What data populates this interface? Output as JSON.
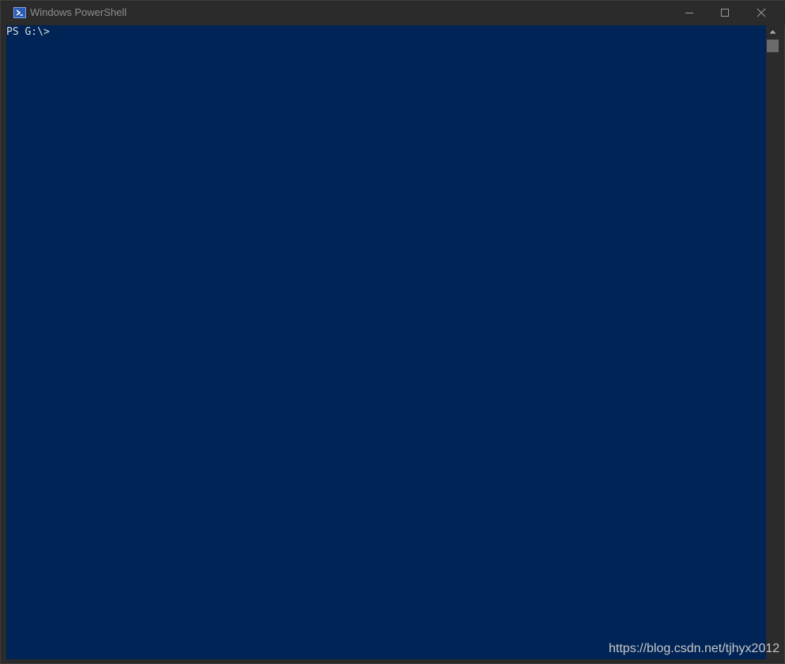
{
  "window": {
    "title": "Windows PowerShell",
    "icon": "powershell-icon",
    "controls": {
      "minimize_icon": "minimize-icon",
      "maximize_icon": "maximize-icon",
      "close_icon": "close-icon"
    }
  },
  "console": {
    "prompt": "PS G:\\>",
    "background_color": "#012456",
    "text_color": "#dcdcdc"
  },
  "watermark": {
    "text": "https://blog.csdn.net/tjhyx2012"
  }
}
